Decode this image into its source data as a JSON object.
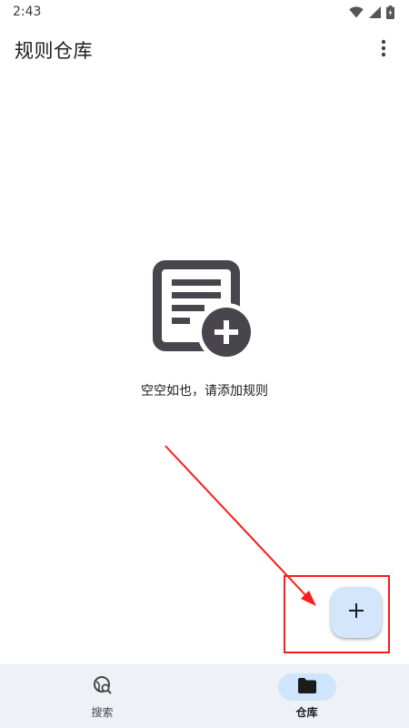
{
  "status_bar": {
    "time": "2:43",
    "icons": [
      "wifi-icon",
      "signal-icon",
      "battery-icon"
    ]
  },
  "app_bar": {
    "title": "规则仓库",
    "menu_icon": "more-vert-icon"
  },
  "empty_state": {
    "icon": "document-add-icon",
    "message": "空空如也，请添加规则"
  },
  "fab": {
    "icon": "plus-icon",
    "label": "+"
  },
  "bottom_nav": {
    "items": [
      {
        "label": "搜索",
        "icon": "search-globe-icon",
        "active": false
      },
      {
        "label": "仓库",
        "icon": "folder-icon",
        "active": true
      }
    ]
  },
  "colors": {
    "fab_bg": "#d3e6fb",
    "nav_bg": "#eef2f7",
    "nav_active_pill": "#cfe5fb",
    "annotation": "#ff1a1a",
    "icon_dark": "#48464c"
  }
}
